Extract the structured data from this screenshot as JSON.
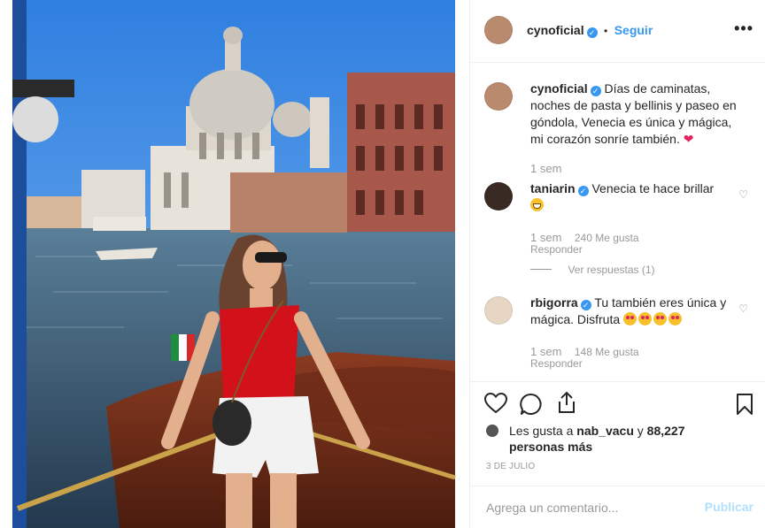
{
  "post": {
    "author": "cynoficial",
    "follow_label": "Seguir",
    "separator": "•",
    "more_label": "•••",
    "caption": "Días de caminatas, noches de pasta y bellinis y paseo en góndola, Venecia es única y mágica, mi corazón sonríe también.",
    "caption_time": "1 sem"
  },
  "comments": [
    {
      "user": "taniarin",
      "text": "Venecia te hace brillar",
      "time": "1 sem",
      "likes": "240 Me gusta",
      "reply_label": "Responder",
      "view_replies": "Ver respuestas (1)"
    },
    {
      "user": "rbigorra",
      "text": "Tu también eres única y mágica. Disfruta",
      "time": "1 sem",
      "likes": "148 Me gusta",
      "reply_label": "Responder"
    }
  ],
  "likes": {
    "prefix": "Les gusta a",
    "first_user": "nab_vacu",
    "joiner": "y",
    "count_text": "88,227 personas más"
  },
  "date": "3 DE JULIO",
  "add_comment": {
    "placeholder": "Agrega un comentario...",
    "publish_label": "Publicar"
  },
  "icons": {
    "like": "heart-icon",
    "comment": "comment-icon",
    "share": "share-icon",
    "save": "bookmark-icon",
    "verified": "verified-badge-icon"
  },
  "colors": {
    "accent": "#3897f0",
    "publish_disabled": "#b2dffc",
    "text": "#262626",
    "muted": "#999999",
    "heart": "#ed4956"
  }
}
